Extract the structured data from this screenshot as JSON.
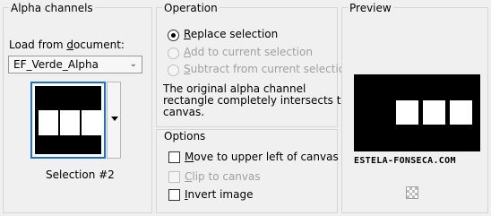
{
  "alpha_channels": {
    "title": "Alpha channels",
    "load_label_pre": "Load from ",
    "load_label_ul": "d",
    "load_label_post": "ocument:",
    "document_value": "EF_Verde_Alpha",
    "selection_label": "Selection #2"
  },
  "operation": {
    "title": "Operation",
    "options": [
      {
        "ul": "R",
        "rest": "eplace selection",
        "checked": true,
        "disabled": false
      },
      {
        "ul": "A",
        "rest": "dd to current selection",
        "checked": false,
        "disabled": true
      },
      {
        "ul": "S",
        "rest": "ubtract from current selection",
        "checked": false,
        "disabled": true
      }
    ],
    "message_lines": [
      "The original alpha channel",
      "rectangle completely intersects the",
      "canvas."
    ]
  },
  "options": {
    "title": "Options",
    "items": [
      {
        "ul": "M",
        "rest": "ove to upper left of canvas",
        "checked": false,
        "disabled": false
      },
      {
        "ul": "C",
        "rest": "lip to canvas",
        "checked": false,
        "disabled": true
      },
      {
        "ul": "I",
        "rest": "nvert image",
        "checked": false,
        "disabled": false
      }
    ]
  },
  "preview": {
    "title": "Preview",
    "watermark": "ESTELA-FONSECA.COM"
  },
  "colors": {
    "selection_border": "#1e70c8",
    "frame_border": "#d5d5d5",
    "background": "#f0f0f0"
  }
}
